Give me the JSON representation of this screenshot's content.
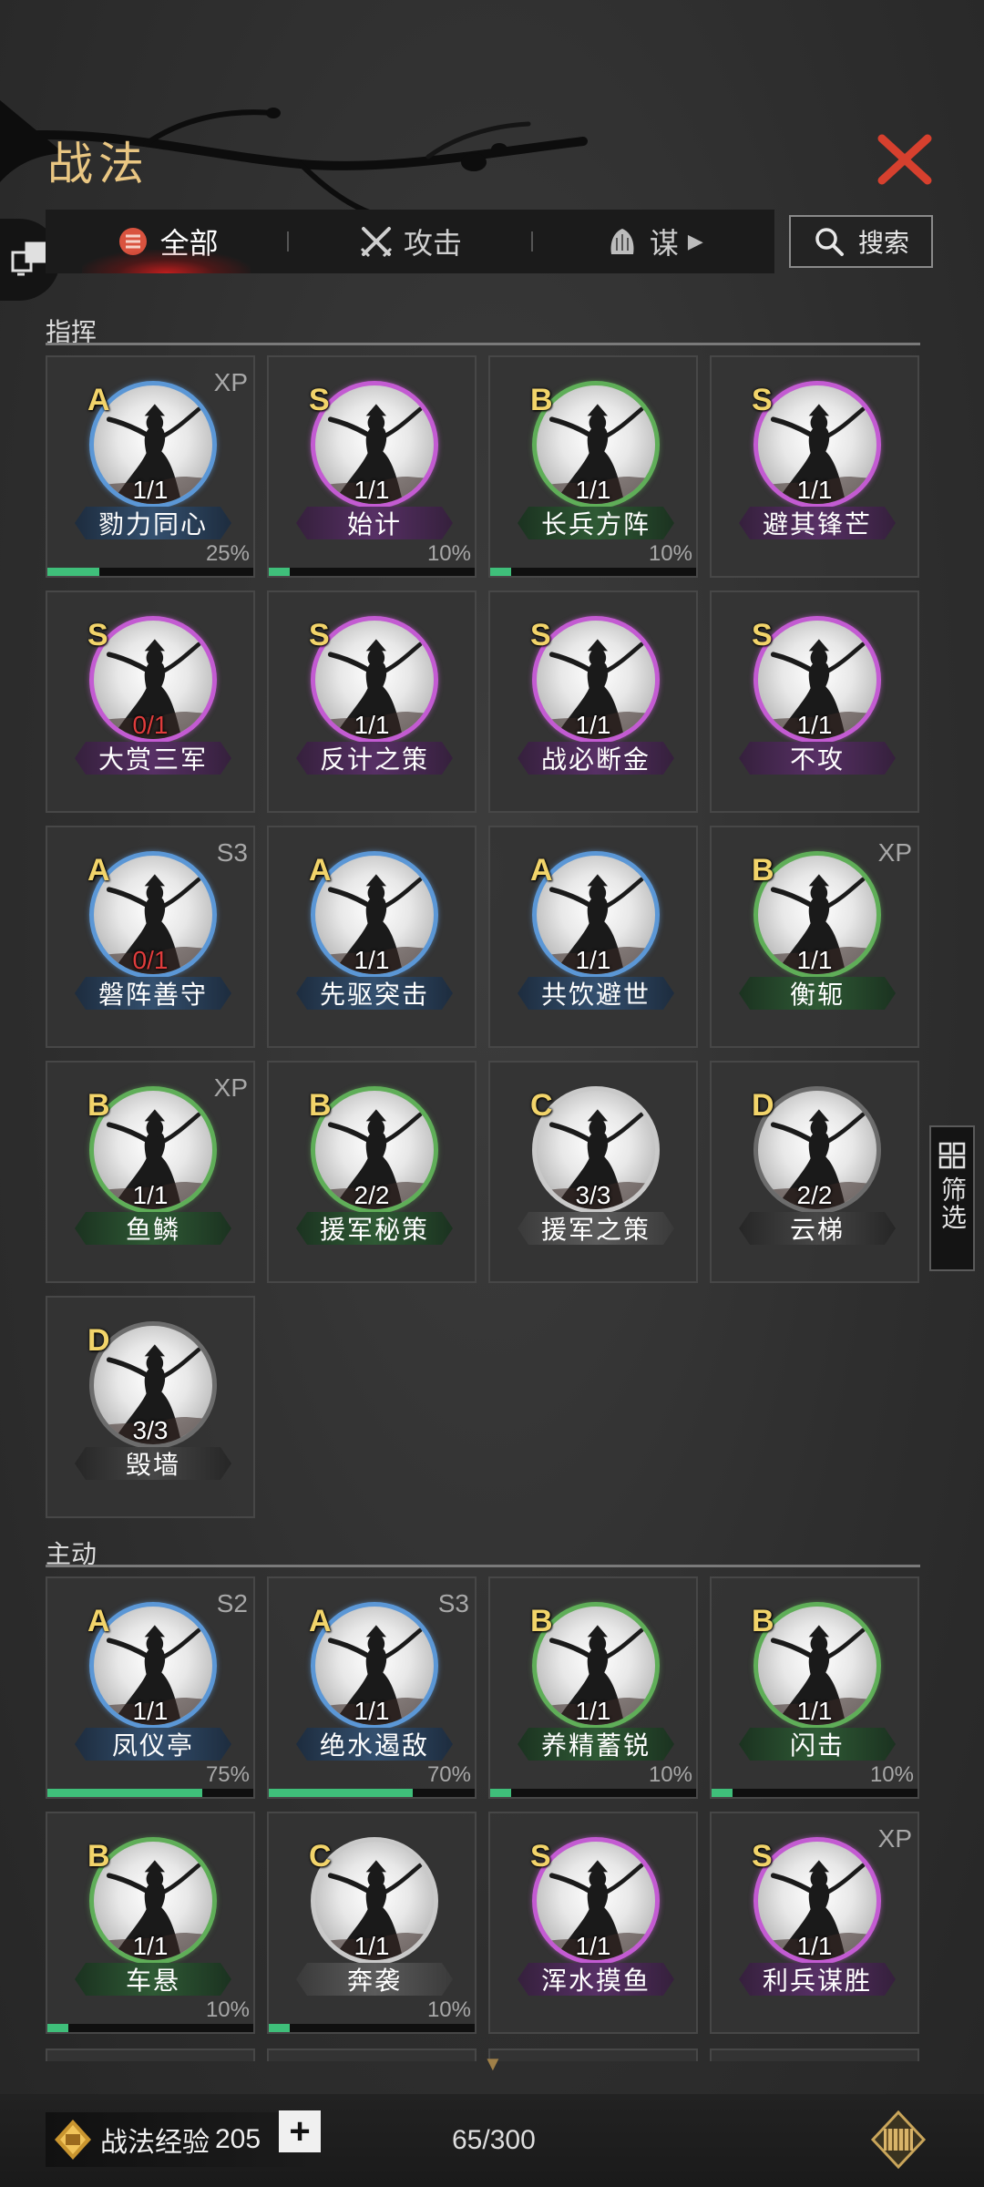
{
  "header": {
    "title": "战法"
  },
  "tabs": [
    {
      "label": "全部",
      "icon": "all-icon",
      "active": true
    },
    {
      "label": "攻击",
      "icon": "swords-icon",
      "active": false
    },
    {
      "label": "谋",
      "icon": "strategy-icon",
      "active": false
    }
  ],
  "search": {
    "label": "搜索"
  },
  "filter": {
    "label": "筛选"
  },
  "grade_colors": {
    "A": "#5b97d6",
    "S": "#c35bd2",
    "B": "#5fae58",
    "C": "#c9c9c9",
    "D": "#6c6c6c"
  },
  "sections": [
    {
      "label": "指挥",
      "cards": [
        {
          "grade": "A",
          "tag": "XP",
          "count": "1/1",
          "name": "勠力同心",
          "pct_label": "25%",
          "progress": 0.25
        },
        {
          "grade": "S",
          "tag": "",
          "count": "1/1",
          "name": "始计",
          "pct_label": "10%",
          "progress": 0.1
        },
        {
          "grade": "B",
          "tag": "",
          "count": "1/1",
          "name": "长兵方阵",
          "pct_label": "10%",
          "progress": 0.1
        },
        {
          "grade": "S",
          "tag": "",
          "count": "1/1",
          "name": "避其锋芒",
          "pct_label": "",
          "progress": null
        },
        {
          "grade": "S",
          "tag": "",
          "count": "0/1",
          "name": "大赏三军",
          "pct_label": "",
          "progress": null
        },
        {
          "grade": "S",
          "tag": "",
          "count": "1/1",
          "name": "反计之策",
          "pct_label": "",
          "progress": null
        },
        {
          "grade": "S",
          "tag": "",
          "count": "1/1",
          "name": "战必断金",
          "pct_label": "",
          "progress": null
        },
        {
          "grade": "S",
          "tag": "",
          "count": "1/1",
          "name": "不攻",
          "pct_label": "",
          "progress": null
        },
        {
          "grade": "A",
          "tag": "S3",
          "count": "0/1",
          "name": "磐阵善守",
          "pct_label": "",
          "progress": null
        },
        {
          "grade": "A",
          "tag": "",
          "count": "1/1",
          "name": "先驱突击",
          "pct_label": "",
          "progress": null
        },
        {
          "grade": "A",
          "tag": "",
          "count": "1/1",
          "name": "共饮避世",
          "pct_label": "",
          "progress": null
        },
        {
          "grade": "B",
          "tag": "XP",
          "count": "1/1",
          "name": "衡轭",
          "pct_label": "",
          "progress": null
        },
        {
          "grade": "B",
          "tag": "XP",
          "count": "1/1",
          "name": "鱼鳞",
          "pct_label": "",
          "progress": null
        },
        {
          "grade": "B",
          "tag": "",
          "count": "2/2",
          "name": "援军秘策",
          "pct_label": "",
          "progress": null
        },
        {
          "grade": "C",
          "tag": "",
          "count": "3/3",
          "name": "援军之策",
          "pct_label": "",
          "progress": null
        },
        {
          "grade": "D",
          "tag": "",
          "count": "2/2",
          "name": "云梯",
          "pct_label": "",
          "progress": null
        },
        {
          "grade": "D",
          "tag": "",
          "count": "3/3",
          "name": "毁墙",
          "pct_label": "",
          "progress": null
        }
      ]
    },
    {
      "label": "主动",
      "cards": [
        {
          "grade": "A",
          "tag": "S2",
          "count": "1/1",
          "name": "凤仪亭",
          "pct_label": "75%",
          "progress": 0.75
        },
        {
          "grade": "A",
          "tag": "S3",
          "count": "1/1",
          "name": "绝水遏敌",
          "pct_label": "70%",
          "progress": 0.7
        },
        {
          "grade": "B",
          "tag": "",
          "count": "1/1",
          "name": "养精蓄锐",
          "pct_label": "10%",
          "progress": 0.1
        },
        {
          "grade": "B",
          "tag": "",
          "count": "1/1",
          "name": "闪击",
          "pct_label": "10%",
          "progress": 0.1
        },
        {
          "grade": "B",
          "tag": "",
          "count": "1/1",
          "name": "车悬",
          "pct_label": "10%",
          "progress": 0.1
        },
        {
          "grade": "C",
          "tag": "",
          "count": "1/1",
          "name": "奔袭",
          "pct_label": "10%",
          "progress": 0.1
        },
        {
          "grade": "S",
          "tag": "",
          "count": "1/1",
          "name": "浑水摸鱼",
          "pct_label": "",
          "progress": null
        },
        {
          "grade": "S",
          "tag": "XP",
          "count": "1/1",
          "name": "利兵谋胜",
          "pct_label": "",
          "progress": null
        }
      ]
    }
  ],
  "footer": {
    "exp_label": "战法经验",
    "exp_value": "205",
    "plus": "+",
    "capacity": "65/300"
  }
}
